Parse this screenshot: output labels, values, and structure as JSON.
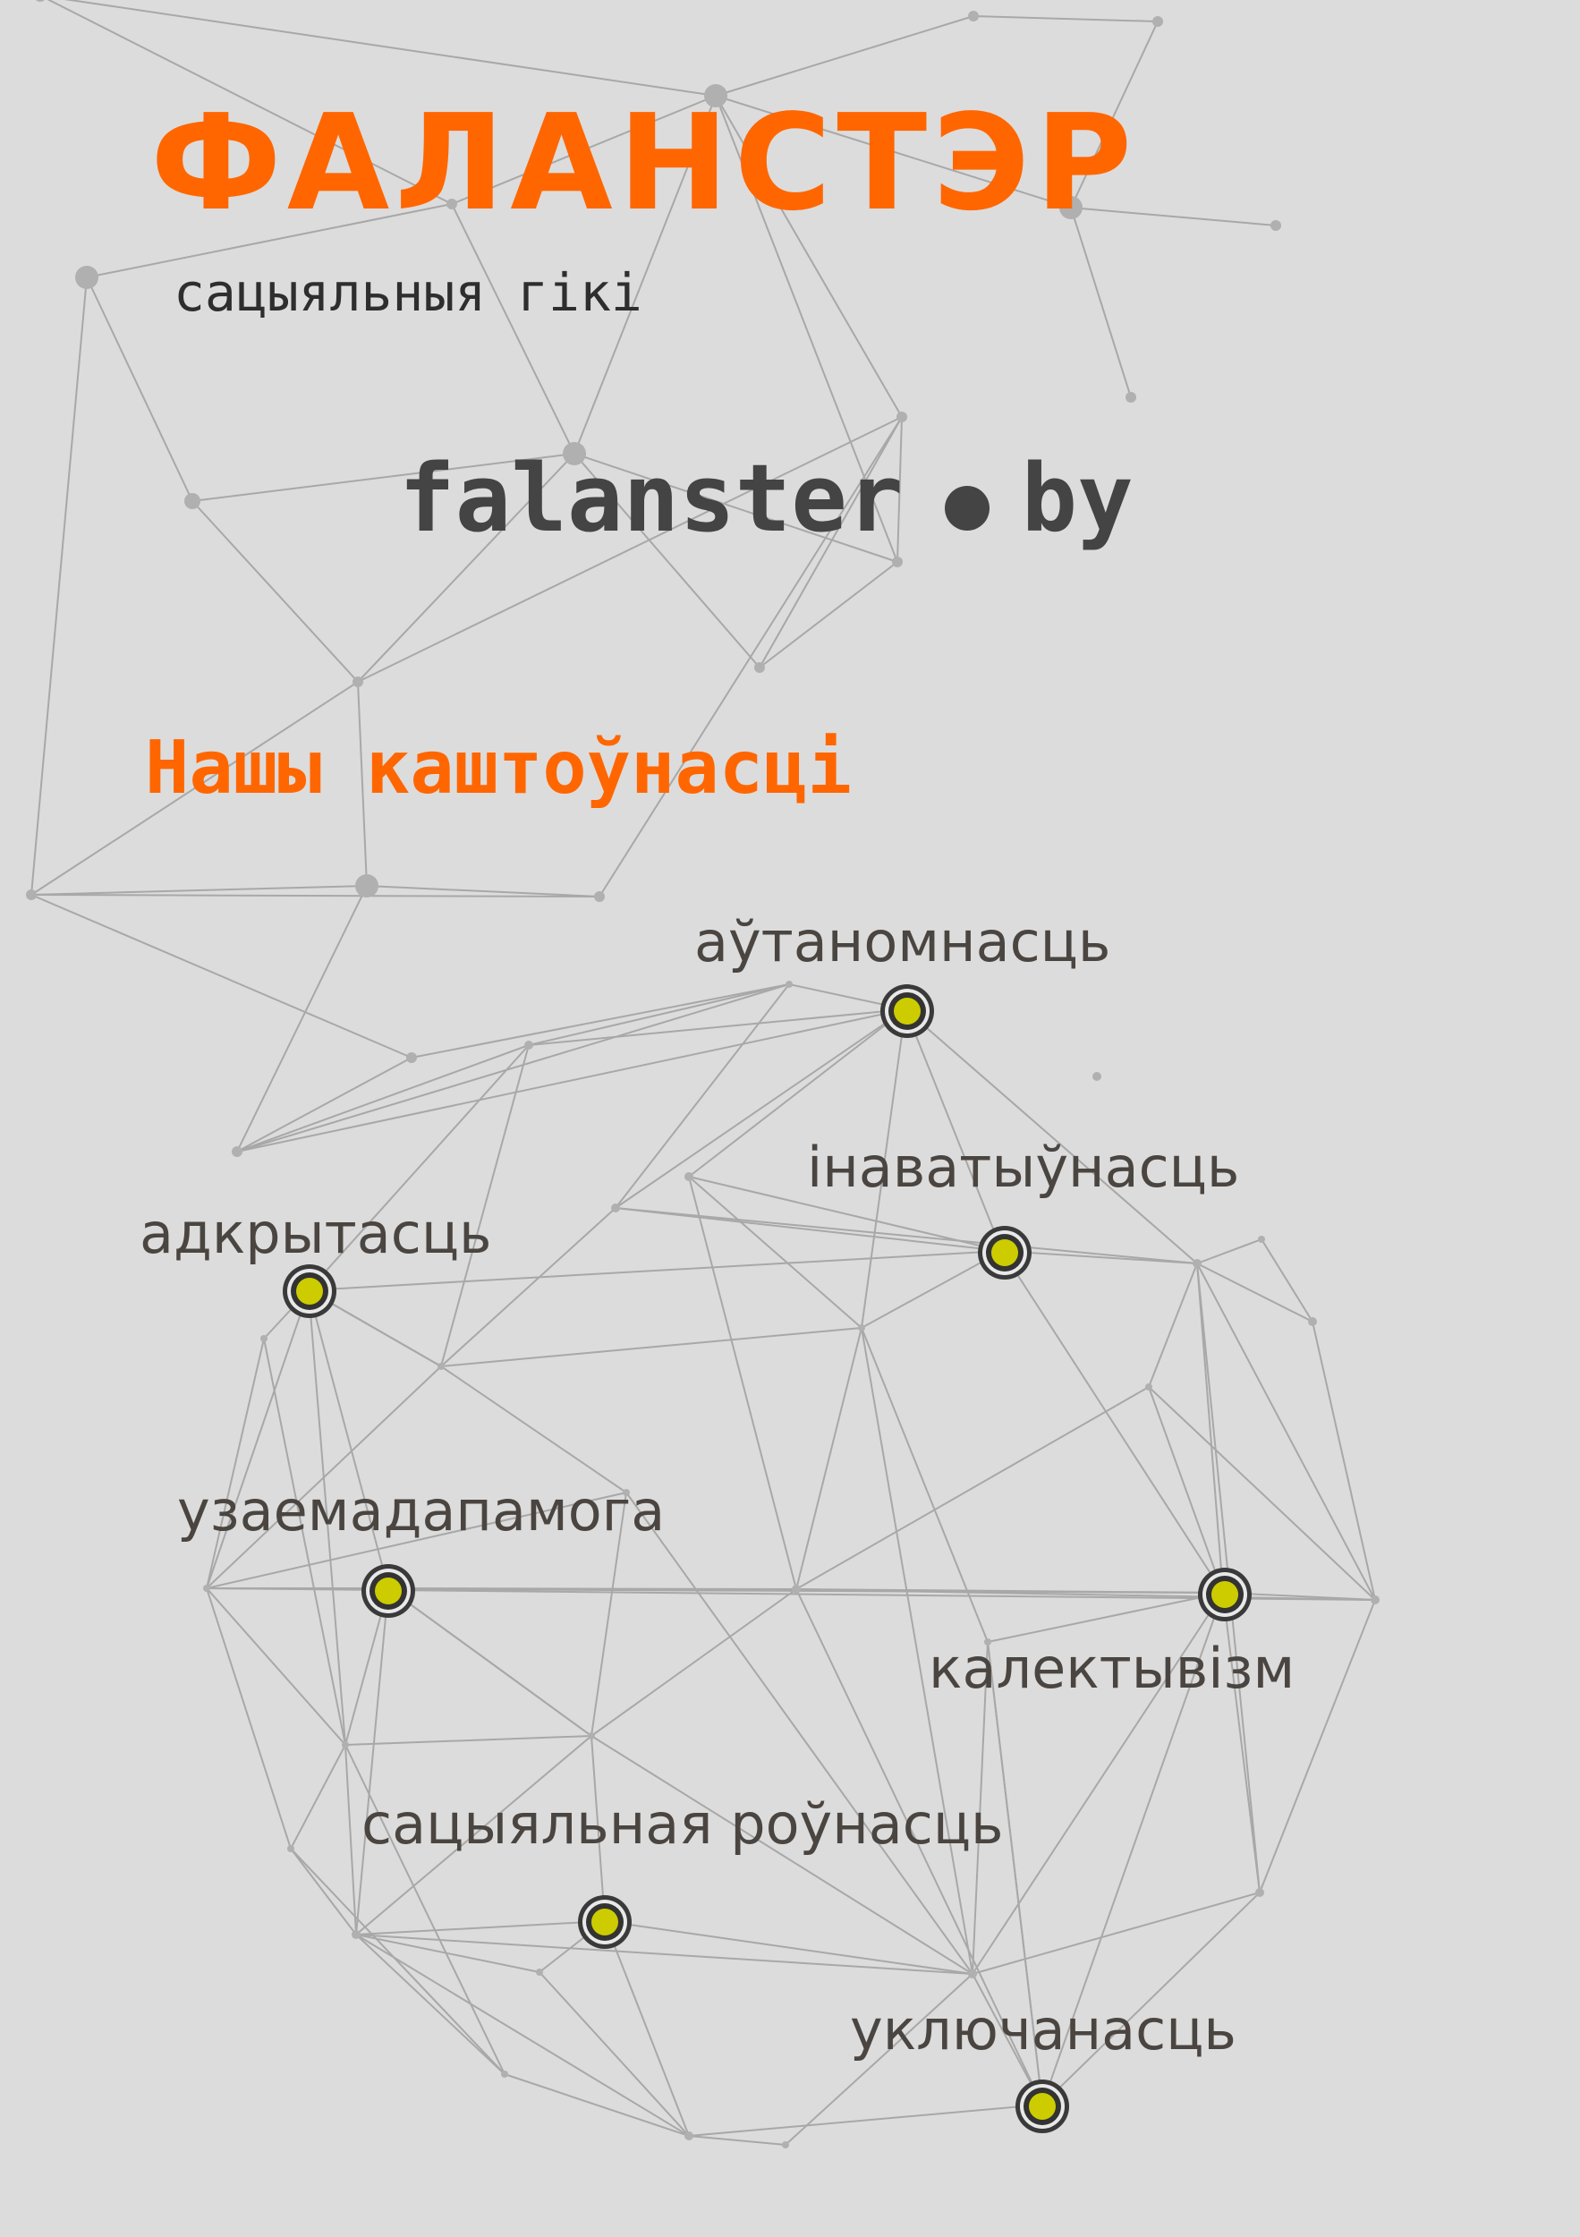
{
  "brand": {
    "title": "ФАЛАНСТЭР",
    "tagline": "сацыяльныя гікі"
  },
  "website": {
    "name": "falanster",
    "tld": "by"
  },
  "values_section": {
    "heading": "Нашы каштоўнасці",
    "items": [
      "аўтаномнасць",
      "інаватыўнасць",
      "адкрытасць",
      "узаемадапамога",
      "калектывізм",
      "сацыяльная роўнасць",
      "уключанасць"
    ]
  },
  "colors": {
    "accent": "#ff6600",
    "text_dark": "#444444",
    "node_fill": "#cccc00",
    "background": "#dcdcdc"
  }
}
